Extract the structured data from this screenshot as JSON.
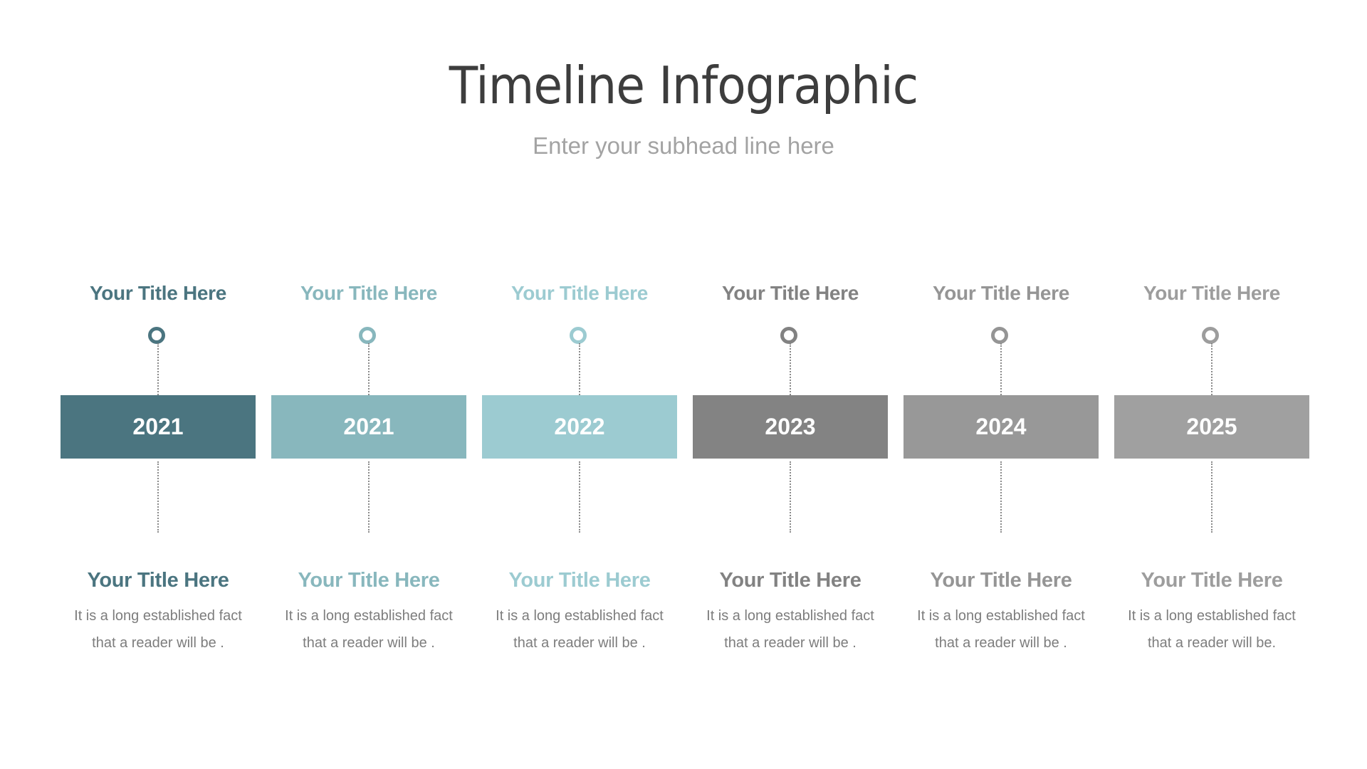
{
  "header": {
    "title": "Timeline Infographic",
    "subhead": "Enter your subhead line here"
  },
  "milestones": [
    {
      "top_title": "Your Title Here",
      "year": "2021",
      "bottom_title": "Your Title Here",
      "desc_line1": "It is a long established fact",
      "desc_line2": "that a reader will be .",
      "color": "#4b7580",
      "box_color": "#4b7580"
    },
    {
      "top_title": "Your Title Here",
      "year": "2021",
      "bottom_title": "Your Title Here",
      "desc_line1": "It is a long established fact",
      "desc_line2": "that a reader will be .",
      "color": "#88b7bd",
      "box_color": "#88b7bd"
    },
    {
      "top_title": "Your Title Here",
      "year": "2022",
      "bottom_title": "Your Title Here",
      "desc_line1": "It is a long established fact",
      "desc_line2": "that a reader will be .",
      "color": "#9ccbd1",
      "box_color": "#9ccbd1"
    },
    {
      "top_title": "Your Title Here",
      "year": "2023",
      "bottom_title": "Your Title Here",
      "desc_line1": "It is a long established fact",
      "desc_line2": "that a reader will be .",
      "color": "#828282",
      "box_color": "#838383"
    },
    {
      "top_title": "Your Title Here",
      "year": "2024",
      "bottom_title": "Your Title Here",
      "desc_line1": "It is a long established fact",
      "desc_line2": "that a reader will be .",
      "color": "#959595",
      "box_color": "#989898"
    },
    {
      "top_title": "Your Title Here",
      "year": "2025",
      "bottom_title": "Your Title Here",
      "desc_line1": "It is a long established fact",
      "desc_line2": "that a reader will be.",
      "color": "#9d9d9d",
      "box_color": "#a0a0a0"
    }
  ]
}
